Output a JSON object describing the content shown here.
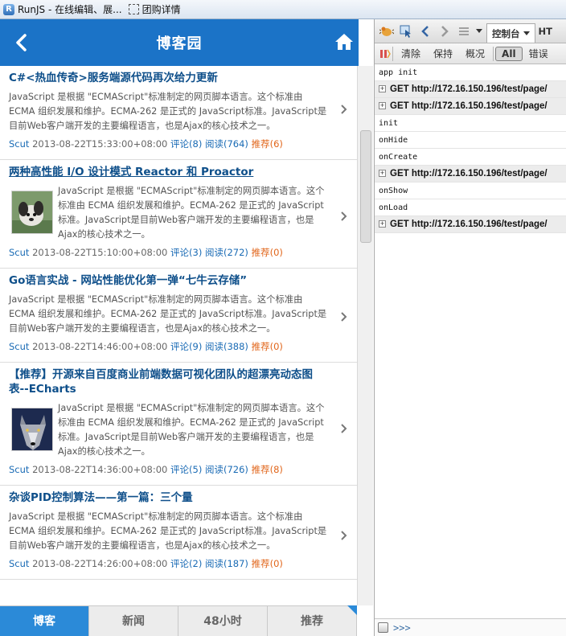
{
  "browser": {
    "tabs": [
      {
        "title": "RunJS - 在线编辑、展..."
      },
      {
        "title": "团购详情"
      }
    ]
  },
  "app": {
    "header_title": "博客园",
    "posts": [
      {
        "title": "C#<热血传奇>服务端源代码再次给力更新",
        "summary": "JavaScript 是根据 \"ECMAScript\"标准制定的网页脚本语言。这个标准由 ECMA 组织发展和维护。ECMA-262 是正式的 JavaScript标准。JavaScript是目前Web客户端开发的主要编程语言，也是Ajax的核心技术之一。",
        "author": "Scut",
        "time": "2013-08-22T15:33:00+08:00",
        "comments": "评论(8)",
        "reads": "阅读(764)",
        "recommend": "推荐(6)"
      },
      {
        "title": "两种高性能 I/O 设计模式 Reactor 和 Proactor",
        "summary": "JavaScript 是根据 \"ECMAScript\"标准制定的网页脚本语言。这个标准由 ECMA 组织发展和维护。ECMA-262 是正式的 JavaScript标准。JavaScript是目前Web客户端开发的主要编程语言，也是Ajax的核心技术之一。",
        "author": "Scut",
        "time": "2013-08-22T15:10:00+08:00",
        "comments": "评论(3)",
        "reads": "阅读(272)",
        "recommend": "推荐(0)"
      },
      {
        "title": "Go语言实战 - 网站性能优化第一弹“七牛云存储”",
        "summary": "JavaScript 是根据 \"ECMAScript\"标准制定的网页脚本语言。这个标准由 ECMA 组织发展和维护。ECMA-262 是正式的 JavaScript标准。JavaScript是目前Web客户端开发的主要编程语言，也是Ajax的核心技术之一。",
        "author": "Scut",
        "time": "2013-08-22T14:46:00+08:00",
        "comments": "评论(9)",
        "reads": "阅读(388)",
        "recommend": "推荐(0)"
      },
      {
        "title": "【推荐】开源来自百度商业前端数据可视化团队的超漂亮动态图表--ECharts",
        "summary": "JavaScript 是根据 \"ECMAScript\"标准制定的网页脚本语言。这个标准由 ECMA 组织发展和维护。ECMA-262 是正式的 JavaScript标准。JavaScript是目前Web客户端开发的主要编程语言，也是Ajax的核心技术之一。",
        "author": "Scut",
        "time": "2013-08-22T14:36:00+08:00",
        "comments": "评论(5)",
        "reads": "阅读(726)",
        "recommend": "推荐(8)"
      },
      {
        "title": "杂谈PID控制算法——第一篇：三个量",
        "summary": "JavaScript 是根据 \"ECMAScript\"标准制定的网页脚本语言。这个标准由 ECMA 组织发展和维护。ECMA-262 是正式的 JavaScript标准。JavaScript是目前Web客户端开发的主要编程语言，也是Ajax的核心技术之一。",
        "author": "Scut",
        "time": "2013-08-22T14:26:00+08:00",
        "comments": "评论(2)",
        "reads": "阅读(187)",
        "recommend": "推荐(0)"
      }
    ],
    "bottom_nav": [
      "博客",
      "新闻",
      "48小时",
      "推荐"
    ]
  },
  "devtools": {
    "main_tab": "控制台",
    "next_tab": "HT",
    "subbar": {
      "clear": "清除",
      "persist": "保持",
      "overview": "概况",
      "all": "All",
      "errors": "错误"
    },
    "log": [
      {
        "type": "text",
        "text": "app init"
      },
      {
        "type": "net",
        "text": "GET http://172.16.150.196/test/page/"
      },
      {
        "type": "net",
        "text": "GET http://172.16.150.196/test/page/"
      },
      {
        "type": "text",
        "text": "init"
      },
      {
        "type": "text",
        "text": "onHide"
      },
      {
        "type": "text",
        "text": "onCreate"
      },
      {
        "type": "net",
        "text": "GET http://172.16.150.196/test/page/"
      },
      {
        "type": "text",
        "text": "onShow"
      },
      {
        "type": "text",
        "text": "onLoad"
      },
      {
        "type": "net",
        "text": "GET http://172.16.150.196/test/page/"
      }
    ],
    "command_prompt": ">>>"
  },
  "colors": {
    "header_blue": "#1b73c7",
    "title_blue": "#0e4f8a",
    "link_blue": "#1a6bb5",
    "recommend_orange": "#e1651a",
    "nav_active": "#2b8ad8"
  }
}
